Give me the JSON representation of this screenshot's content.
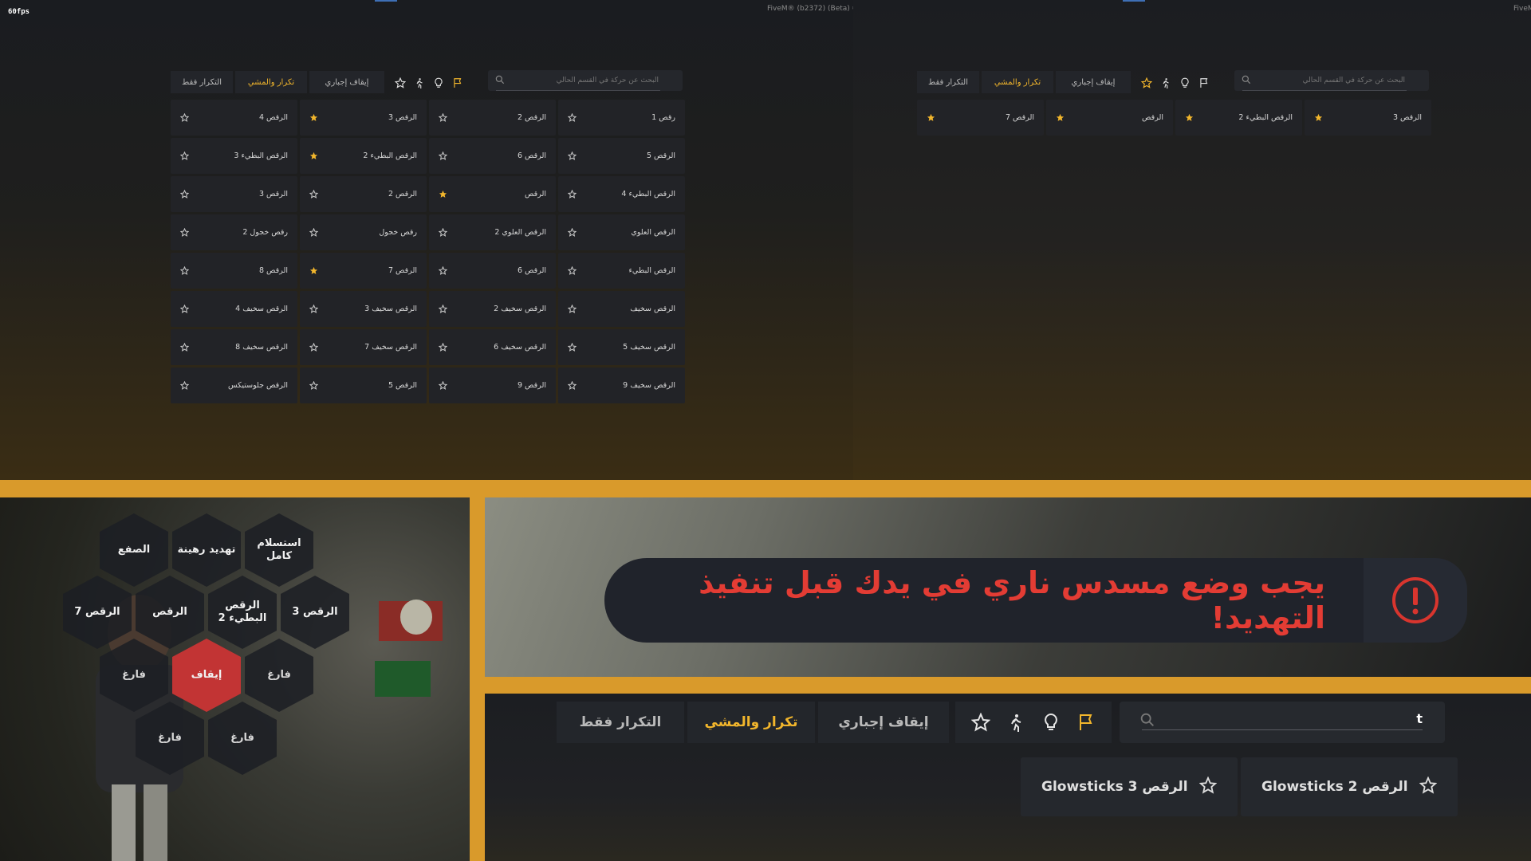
{
  "overlay": {
    "fps": "60fps",
    "client": "FiveM® (b2372) (Beta)",
    "client_short": "FiveM"
  },
  "colors": {
    "accent": "#f2b62c",
    "frame": "#d99a2b",
    "stop": "#c23434",
    "warning_text": "#e33c34"
  },
  "menu": {
    "search_placeholder": "البحث عن حركة في القسم الحالي",
    "buttons": {
      "loop_only": "التكرار فقط",
      "loop_walk": "تكرار والمشي",
      "force_stop": "إيقاف إجباري"
    },
    "icons": [
      "flag-icon",
      "bulb-icon",
      "walk-icon",
      "star-icon"
    ]
  },
  "emote_grid": [
    {
      "label": "رقص 1",
      "fav": false
    },
    {
      "label": "الرقص 2",
      "fav": false
    },
    {
      "label": "الرقص 3",
      "fav": true
    },
    {
      "label": "الرقص 4",
      "fav": false
    },
    {
      "label": "الرقص 5",
      "fav": false
    },
    {
      "label": "الرقص 6",
      "fav": false
    },
    {
      "label": "الرقص البطيء 2",
      "fav": true
    },
    {
      "label": "الرقص البطيء 3",
      "fav": false
    },
    {
      "label": "الرقص البطيء 4",
      "fav": false
    },
    {
      "label": "الرقص",
      "fav": true
    },
    {
      "label": "الرقص 2",
      "fav": false
    },
    {
      "label": "الرقص 3",
      "fav": false
    },
    {
      "label": "الرقص العلوي",
      "fav": false
    },
    {
      "label": "الرقص العلوي 2",
      "fav": false
    },
    {
      "label": "رقص خجول",
      "fav": false
    },
    {
      "label": "رقص خجول 2",
      "fav": false
    },
    {
      "label": "الرقص البطيء",
      "fav": false
    },
    {
      "label": "الرقص 6",
      "fav": false
    },
    {
      "label": "الرقص 7",
      "fav": true
    },
    {
      "label": "الرقص 8",
      "fav": false
    },
    {
      "label": "الرقص سخيف",
      "fav": false
    },
    {
      "label": "الرقص سخيف 2",
      "fav": false
    },
    {
      "label": "الرقص سخيف 3",
      "fav": false
    },
    {
      "label": "الرقص سخيف 4",
      "fav": false
    },
    {
      "label": "الرقص سخيف 5",
      "fav": false
    },
    {
      "label": "الرقص سخيف 6",
      "fav": false
    },
    {
      "label": "الرقص سخيف 7",
      "fav": false
    },
    {
      "label": "الرقص سخيف 8",
      "fav": false
    },
    {
      "label": "الرقص سخيف 9",
      "fav": false
    },
    {
      "label": "الرقص 9",
      "fav": false
    },
    {
      "label": "الرقص 5",
      "fav": false
    },
    {
      "label": "الرقص جلوستيكس",
      "fav": false
    }
  ],
  "favorites_grid": [
    {
      "label": "الرقص 3",
      "fav": true
    },
    {
      "label": "الرقص البطيء 2",
      "fav": true
    },
    {
      "label": "الرقص",
      "fav": true
    },
    {
      "label": "الرقص 7",
      "fav": true
    }
  ],
  "radial": {
    "row1": [
      "استسلام كامل",
      "تهديد رهينة",
      "الصفع"
    ],
    "row2": [
      "الرقص 3",
      "الرقص البطيء 2",
      "الرقص",
      "الرقص 7"
    ],
    "row3": [
      "فارغ",
      "إيقاف",
      "فارغ"
    ],
    "row4": [
      "فارغ",
      "فارغ"
    ]
  },
  "notification": {
    "text": "يجب وضع مسدس ناري في يدك قبل تنفيذ التهديد!",
    "icon": "alert-circle-icon"
  },
  "zoom_menu": {
    "search_value": "t",
    "results": [
      {
        "label": "Glowsticks الرقص 2",
        "fav": false
      },
      {
        "label": "Glowsticks الرقص 3",
        "fav": false
      }
    ]
  }
}
